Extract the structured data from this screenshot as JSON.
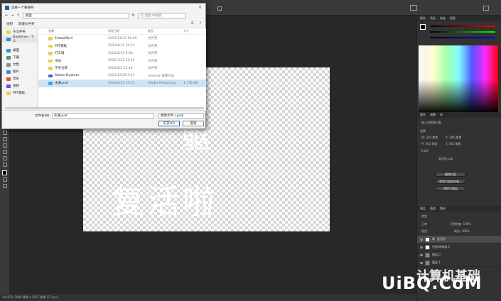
{
  "dialog": {
    "title": "选择一个要保存",
    "path_root": "桌面",
    "search_placeholder": "在 桌面 中搜索",
    "organize": "组织",
    "new_folder": "新建文件夹",
    "nav": [
      {
        "label": "主文件夹",
        "color": "#f2c94c"
      },
      {
        "label": "OneDrive - 个人",
        "color": "#2f86d6"
      },
      {
        "label": "桌面",
        "color": "#3b8ed6"
      },
      {
        "label": "下载",
        "color": "#3aa55e"
      },
      {
        "label": "文档",
        "color": "#8a8a8a"
      },
      {
        "label": "图片",
        "color": "#3b8ed6"
      },
      {
        "label": "音乐",
        "color": "#e0533b"
      },
      {
        "label": "视频",
        "color": "#7a4cd1"
      },
      {
        "label": "PPT模板",
        "color": "#f2c94c"
      }
    ],
    "columns": {
      "name": "名称",
      "date": "修改日期",
      "type": "类型",
      "size": "大小"
    },
    "files": [
      {
        "name": "EdrawMind",
        "date": "2023/11/22 16:49",
        "type": "文件夹",
        "size": "",
        "selected": false,
        "kind": "folder"
      },
      {
        "name": "PPT模板",
        "date": "2023/4/11 20:24",
        "type": "文件夹",
        "size": "",
        "selected": false,
        "kind": "folder"
      },
      {
        "name": "打工魂",
        "date": "2023/4/12 9:38",
        "type": "文件夹",
        "size": "",
        "selected": false,
        "kind": "folder"
      },
      {
        "name": "书法",
        "date": "2022/7/21 22:45",
        "type": "文件夹",
        "size": "",
        "selected": false,
        "kind": "folder"
      },
      {
        "name": "学术合练",
        "date": "2023/4/1 22:46",
        "type": "文件夹",
        "size": "",
        "selected": false,
        "kind": "folder"
      },
      {
        "name": "Steam Dyskom",
        "date": "2023/12/28 9:41",
        "type": "Internet 快捷方式",
        "size": "",
        "selected": false,
        "kind": "link"
      },
      {
        "name": "水通.psd",
        "date": "2023/4/12 17:51",
        "type": "Adobe Photoshop...",
        "size": "1,736 KB",
        "selected": true,
        "kind": "psd"
      }
    ],
    "filename_label": "文件名(N):",
    "filename_value": "水通.psd",
    "filetype_value": "图像文件 (.psd)",
    "open_button": "打开(O)",
    "cancel_button": "取消"
  },
  "canvas": {
    "text_main": "复活啦",
    "text_top": "躯"
  },
  "status": {
    "text": "66.67%   3840 像素 x 2457 像素 (72 ppi)"
  },
  "panels": {
    "color_tabs": [
      "颜色",
      "色板",
      "渐变",
      "图案"
    ],
    "props_tabs": [
      "属性",
      "调整",
      "库"
    ],
    "props_title": "嵌入的智能对象",
    "transform_label": "变换",
    "w": "W: 326 像素",
    "x": "X: 286 像素",
    "h": "H: 442 像素",
    "y": "Y: 361 像素",
    "angle": "0.00°",
    "file_label": "复活啦.psb",
    "btn_edit": "编辑内容",
    "btn_convert": "转换为链接对象...",
    "btn_layers": "转换为图层",
    "layers_tabs": [
      "图层",
      "通道",
      "路径"
    ],
    "filter_kind": "类型",
    "blend_mode": "正常",
    "opacity": "不透明度: 100%",
    "lock": "锁定:",
    "fill": "填充: 100%",
    "layers": [
      {
        "name": "复活啦",
        "sub": "躯",
        "active": true
      },
      {
        "name": "色相/饱和度 1",
        "sub": "",
        "active": false
      },
      {
        "name": "图层 0",
        "sub": "",
        "active": false
      },
      {
        "name": "图层 1",
        "sub": "",
        "active": false
      }
    ]
  },
  "watermark": {
    "text": "UiBQ.CoM",
    "sub": "计算机基础"
  }
}
